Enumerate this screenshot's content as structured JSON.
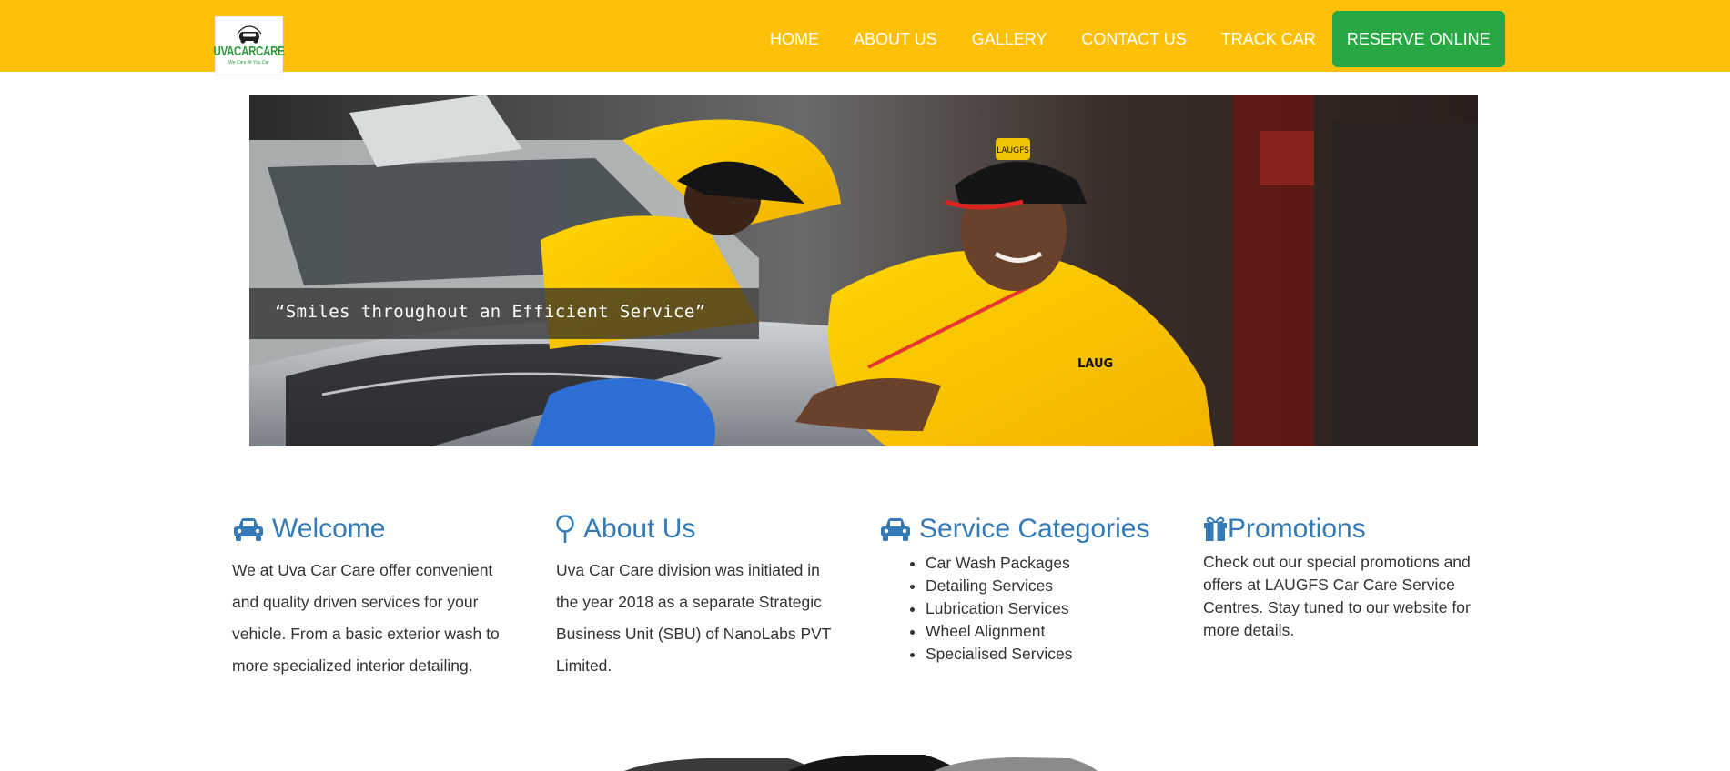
{
  "brand": {
    "name": "UVACARCARE",
    "tagline": "We Care At You Car"
  },
  "nav": {
    "items": [
      {
        "label": "HOME"
      },
      {
        "label": "ABOUT US"
      },
      {
        "label": "GALLERY"
      },
      {
        "label": "CONTACT US"
      },
      {
        "label": "TRACK CAR"
      }
    ],
    "reserve_label": "RESERVE ONLINE"
  },
  "hero": {
    "caption": "“Smiles throughout an Efficient Service”",
    "cap_text": "LAUGFS",
    "shirt_text": "LAUG"
  },
  "sections": {
    "welcome": {
      "title": "Welcome",
      "text": "We at Uva Car Care offer convenient and quality driven services for your vehicle. From a basic exterior wash to more specialized interior detailing."
    },
    "about": {
      "title": "About Us",
      "text": "Uva Car Care division was initiated in the year 2018 as a separate Strategic Business Unit (SBU) of NanoLabs PVT Limited."
    },
    "services": {
      "title": "Service Categories",
      "items": [
        "Car Wash Packages",
        "Detailing Services",
        "Lubrication Services",
        "Wheel Alignment",
        "Specialised Services"
      ]
    },
    "promotions": {
      "title": "Promotions",
      "text": "Check out our special promotions and offers at LAUGFS Car Care Service Centres. Stay tuned to our website for more details."
    }
  },
  "icons": {
    "welcome": "car-icon",
    "about": "map-marker-icon",
    "services": "car-icon",
    "promotions": "gift-icon"
  },
  "colors": {
    "navbar": "#ffc107",
    "reserve_button": "#28a745",
    "heading": "#337ab7",
    "logo_text": "#2a9d3a"
  }
}
